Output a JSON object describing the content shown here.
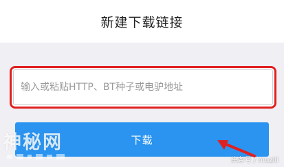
{
  "header": {
    "title": "新建下载链接"
  },
  "url_input": {
    "value": "",
    "placeholder": "输入或粘贴HTTP、BT种子或电驴地址"
  },
  "download_button": {
    "label": "下载"
  },
  "watermark": {
    "logo_text": "神秘网"
  },
  "source_credit": {
    "text": "头条号 / muzili"
  },
  "colors": {
    "accent": "#2a94f0",
    "highlight_border": "#e02020",
    "arrow": "#e02020",
    "background": "#efeff4"
  }
}
